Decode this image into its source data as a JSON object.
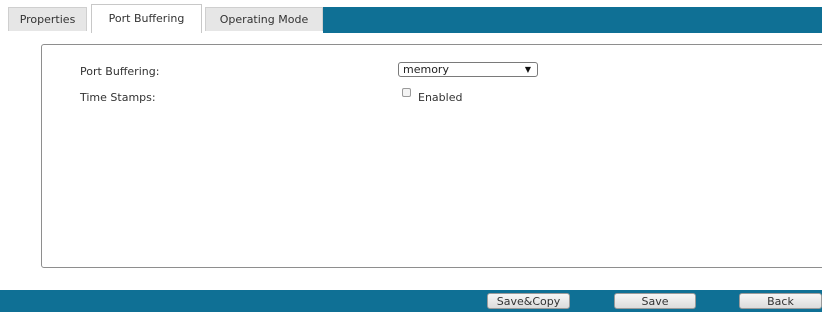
{
  "tabs": [
    {
      "label": "Properties",
      "active": false
    },
    {
      "label": "Port Buffering",
      "active": true
    },
    {
      "label": "Operating Mode",
      "active": false
    }
  ],
  "form": {
    "port_buffering_label": "Port Buffering:",
    "port_buffering_value": "memory",
    "time_stamps_label": "Time Stamps:",
    "time_stamps_checkbox_label": "Enabled",
    "time_stamps_checked": false
  },
  "icons": {
    "dropdown": "chevron-down-icon",
    "dropdown_glyph": "▼"
  },
  "footer": {
    "save_copy_label": "Save&Copy",
    "save_label": "Save",
    "back_label": "Back"
  },
  "colors": {
    "bar": "#0f7095",
    "tab_inactive": "#e6e6e6",
    "panel_border": "#8e8e8e"
  }
}
